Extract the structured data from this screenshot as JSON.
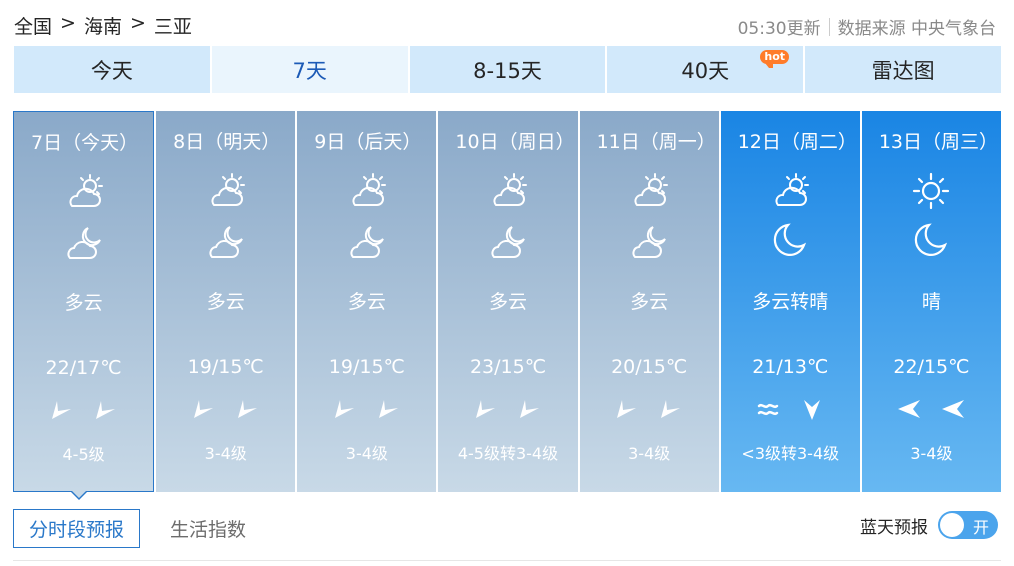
{
  "breadcrumb": {
    "items": [
      "全国",
      "海南",
      "三亚"
    ],
    "separator": ">"
  },
  "source": {
    "update_time": "05:30更新",
    "source_label": "数据来源 中央气象台"
  },
  "tabs": [
    {
      "label": "今天",
      "active": false
    },
    {
      "label": "7天",
      "active": true
    },
    {
      "label": "8-15天",
      "active": false
    },
    {
      "label": "40天",
      "active": false,
      "badge": "hot"
    },
    {
      "label": "雷达图",
      "active": false
    }
  ],
  "days": [
    {
      "date": "7日（今天）",
      "day_icon": "partly-cloudy-day-icon",
      "night_icon": "partly-cloudy-night-icon",
      "weather": "多云",
      "temp": "22/17℃",
      "wind_icons": [
        "arrow-left-down-icon",
        "arrow-left-down-icon"
      ],
      "wind_level": "4-5级",
      "style": "gray",
      "selected": true
    },
    {
      "date": "8日（明天）",
      "day_icon": "partly-cloudy-day-icon",
      "night_icon": "partly-cloudy-night-icon",
      "weather": "多云",
      "temp": "19/15℃",
      "wind_icons": [
        "arrow-left-down-icon",
        "arrow-left-down-icon"
      ],
      "wind_level": "3-4级",
      "style": "gray"
    },
    {
      "date": "9日（后天）",
      "day_icon": "partly-cloudy-day-icon",
      "night_icon": "partly-cloudy-night-icon",
      "weather": "多云",
      "temp": "19/15℃",
      "wind_icons": [
        "arrow-left-down-icon",
        "arrow-left-down-icon"
      ],
      "wind_level": "3-4级",
      "style": "gray"
    },
    {
      "date": "10日（周日）",
      "day_icon": "partly-cloudy-day-icon",
      "night_icon": "partly-cloudy-night-icon",
      "weather": "多云",
      "temp": "23/15℃",
      "wind_icons": [
        "arrow-left-down-icon",
        "arrow-left-down-icon"
      ],
      "wind_level": "4-5级转3-4级",
      "style": "gray"
    },
    {
      "date": "11日（周一）",
      "day_icon": "partly-cloudy-day-icon",
      "night_icon": "partly-cloudy-night-icon",
      "weather": "多云",
      "temp": "20/15℃",
      "wind_icons": [
        "arrow-left-down-icon",
        "arrow-left-down-icon"
      ],
      "wind_level": "3-4级",
      "style": "gray"
    },
    {
      "date": "12日（周二）",
      "day_icon": "partly-cloudy-day-icon",
      "night_icon": "moon-icon",
      "weather": "多云转晴",
      "temp": "21/13℃",
      "wind_icons": [
        "variable-wind-icon",
        "arrow-down-icon"
      ],
      "wind_level": "<3级转3-4级",
      "style": "blue"
    },
    {
      "date": "13日（周三）",
      "day_icon": "sun-icon",
      "night_icon": "moon-icon",
      "weather": "晴",
      "temp": "22/15℃",
      "wind_icons": [
        "arrow-left-icon",
        "arrow-left-icon"
      ],
      "wind_level": "3-4级",
      "style": "blue"
    }
  ],
  "bottom_tabs": [
    {
      "label": "分时段预报",
      "active": true
    },
    {
      "label": "生活指数",
      "active": false
    }
  ],
  "blue_sky": {
    "label": "蓝天预报",
    "toggle_text": "开"
  },
  "colors": {
    "tab_bg": "#d2e9fb",
    "active_tab_text": "#1c5ab6",
    "hot_badge": "#ff7c2a",
    "gray_card_top": "#8aa9c9",
    "blue_card_top": "#1a85e4",
    "toggle": "#4ba4ec"
  }
}
